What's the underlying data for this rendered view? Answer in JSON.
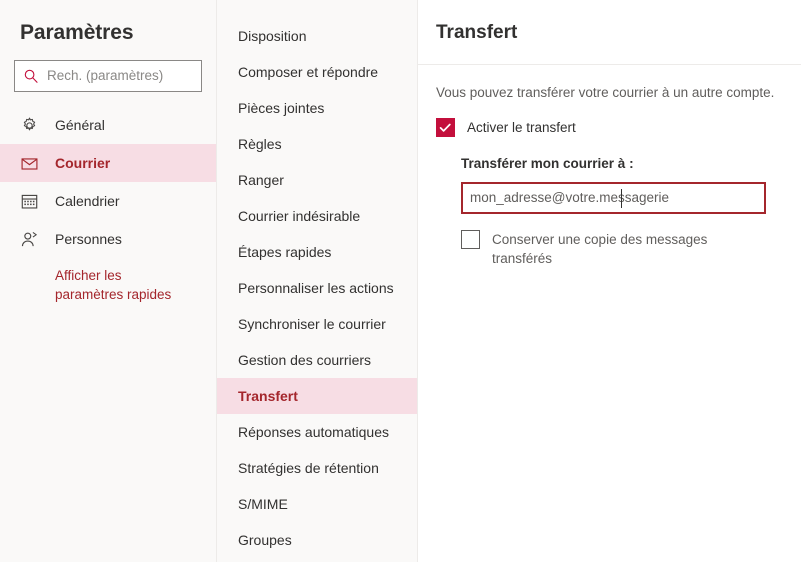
{
  "sidebar": {
    "title": "Paramètres",
    "search": {
      "placeholder": "Rech. (paramètres)",
      "value": "",
      "icon": "search-icon"
    },
    "items": [
      {
        "label": "Général",
        "icon": "gear-icon",
        "selected": false
      },
      {
        "label": "Courrier",
        "icon": "envelope-icon",
        "selected": true
      },
      {
        "label": "Calendrier",
        "icon": "calendar-icon",
        "selected": false
      },
      {
        "label": "Personnes",
        "icon": "person-icon",
        "selected": false
      }
    ],
    "quick_link": "Afficher les paramètres rapides"
  },
  "midcol": {
    "items": [
      {
        "label": "Disposition",
        "selected": false
      },
      {
        "label": "Composer et répondre",
        "selected": false
      },
      {
        "label": "Pièces jointes",
        "selected": false
      },
      {
        "label": "Règles",
        "selected": false
      },
      {
        "label": "Ranger",
        "selected": false
      },
      {
        "label": "Courrier indésirable",
        "selected": false
      },
      {
        "label": "Étapes rapides",
        "selected": false
      },
      {
        "label": "Personnaliser les actions",
        "selected": false
      },
      {
        "label": "Synchroniser le courrier",
        "selected": false
      },
      {
        "label": "Gestion des courriers",
        "selected": false
      },
      {
        "label": "Transfert",
        "selected": true
      },
      {
        "label": "Réponses automatiques",
        "selected": false
      },
      {
        "label": "Stratégies de rétention",
        "selected": false
      },
      {
        "label": "S/MIME",
        "selected": false
      },
      {
        "label": "Groupes",
        "selected": false
      }
    ]
  },
  "panel": {
    "title": "Transfert",
    "description": "Vous pouvez transférer votre courrier à un autre compte.",
    "enable_forwarding": {
      "label": "Activer le transfert",
      "checked": true
    },
    "forward_to": {
      "label": "Transférer mon courrier à :",
      "placeholder": "mon_adresse@votre.messagerie",
      "value": ""
    },
    "keep_copy": {
      "label": "Conserver une copie des messages transférés",
      "checked": false
    }
  },
  "colors": {
    "accent": "#a4262c",
    "checkbox_checked": "#c30f3c",
    "selection_background": "#f7dde4",
    "panel_background": "#faf9f8",
    "text_primary": "#323130",
    "text_secondary": "#605e5c",
    "divider": "#edebe9"
  }
}
